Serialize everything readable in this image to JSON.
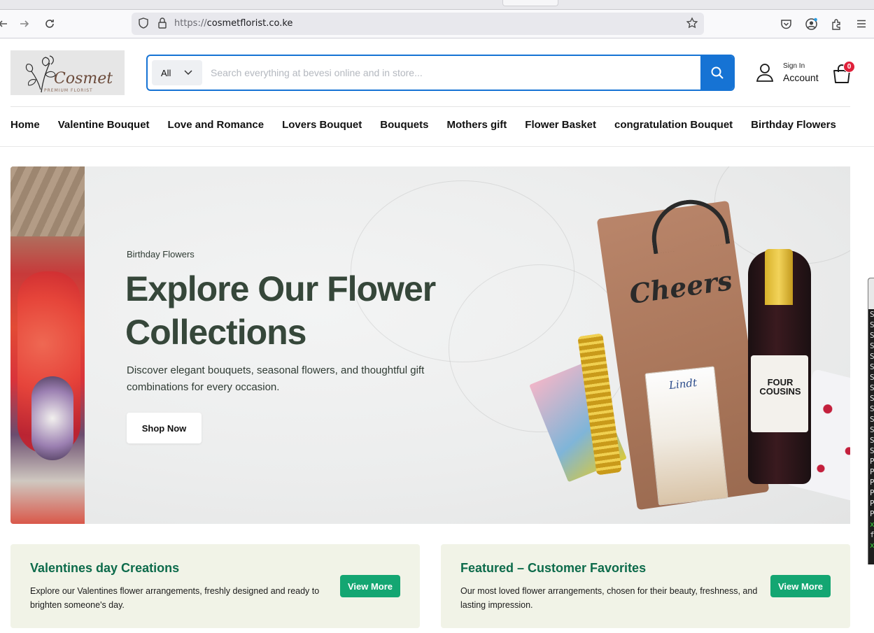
{
  "browser": {
    "url_protocol": "https://",
    "url_host": "cosmetflorist.co.ke"
  },
  "site": {
    "logo_name": "Cosmet",
    "logo_tagline": "PREMIUM FLORIST"
  },
  "search": {
    "category": "All",
    "placeholder": "Search everything at bevesi online and in store..."
  },
  "account": {
    "sign_in": "Sign In",
    "label": "Account"
  },
  "cart": {
    "count": "0"
  },
  "nav": {
    "items": [
      "Home",
      "Valentine Bouquet",
      "Love and Romance",
      "Lovers Bouquet",
      "Bouquets",
      "Mothers gift",
      "Flower Basket",
      "congratulation Bouquet",
      "Birthday Flowers"
    ]
  },
  "hero": {
    "eyebrow": "Birthday Flowers",
    "title": "Explore Our Flower Collections",
    "description": "Discover elegant bouquets, seasonal flowers, and thoughtful gift combinations for every occasion.",
    "cta": "Shop Now",
    "art": {
      "bag_text": "Cheers",
      "chocolate_brand": "Lindt",
      "bottle_label": "FOUR COUSINS"
    }
  },
  "promos": [
    {
      "title": "Valentines day Creations",
      "text": "Explore our Valentines flower arrangements, freshly designed and ready to brighten someone's day.",
      "button": "View More"
    },
    {
      "title": "Featured – Customer Favorites",
      "text": "Our most loved flower arrangements, chosen for their beauty, freshness, and lasting impression.",
      "button": "View More"
    }
  ],
  "terminal": {
    "lines": [
      "S",
      "S",
      "S",
      "S",
      "S",
      "S",
      "S",
      "S",
      "S",
      "S",
      "S",
      "S",
      "S",
      "S",
      "P",
      "P",
      "P",
      "P",
      "P",
      "P",
      "x",
      "f",
      "x"
    ]
  },
  "colors": {
    "accent_blue": "#1673d4",
    "hero_heading": "#36473a",
    "promo_title": "#0d6b4b",
    "promo_button": "#14a672",
    "cart_badge": "#e0203a"
  }
}
